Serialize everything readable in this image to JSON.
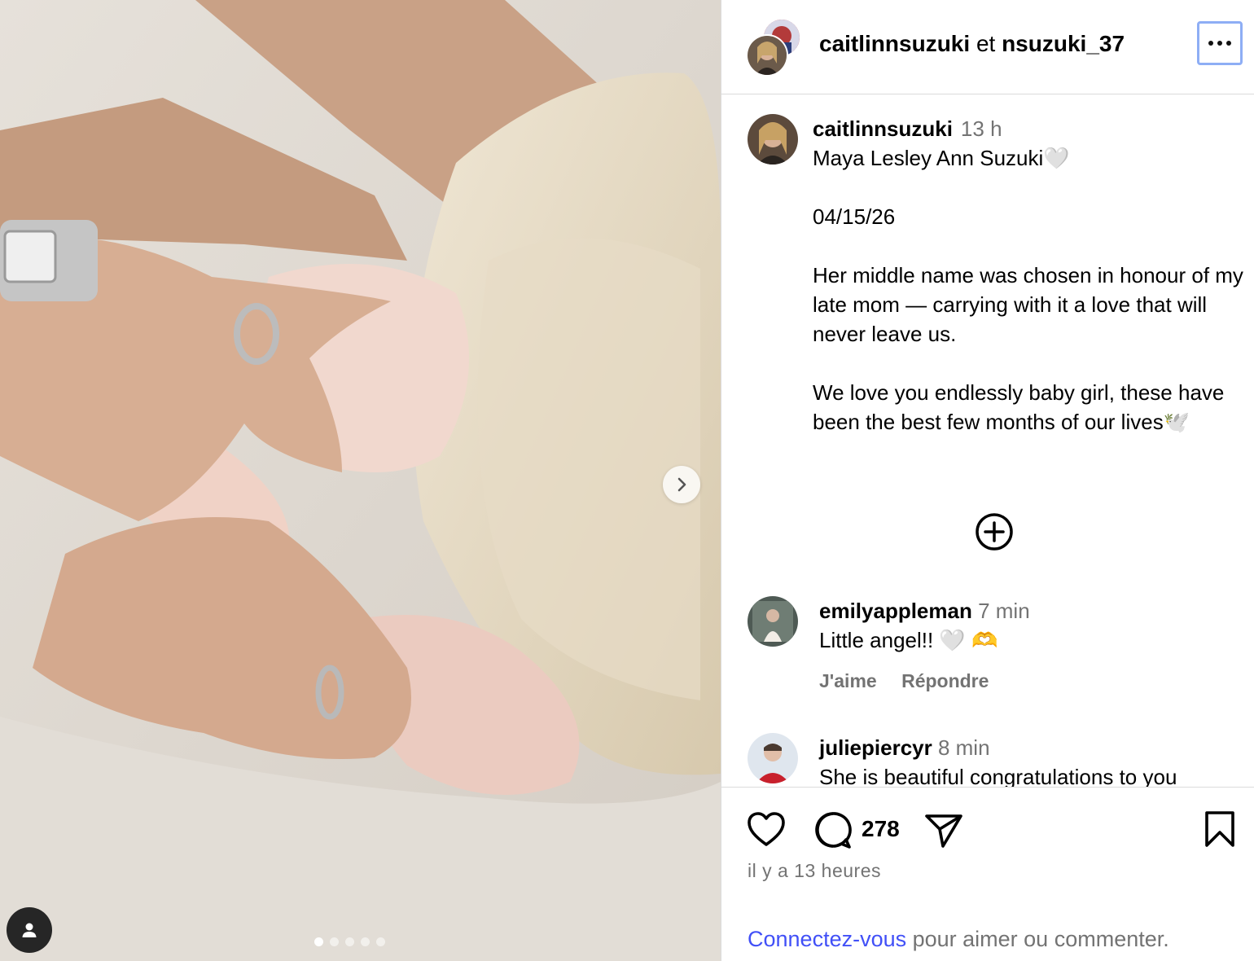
{
  "post": {
    "collaborators": {
      "user1": "caitlinnsuzuki",
      "joiner": "et",
      "user2": "nsuzuki_37"
    },
    "more_label": "More options",
    "media": {
      "slide_count": 5,
      "active_slide": 1
    }
  },
  "caption": {
    "username": "caitlinnsuzuki",
    "time": "13 h",
    "line1": "Maya Lesley Ann Suzuki🤍",
    "line2": "04/15/26",
    "line3": "Her middle name was chosen in honour of my late mom — carrying with it a love that will never leave us.",
    "line4": "We love you endlessly baby girl, these have been the best few months of our lives🕊️"
  },
  "comments": [
    {
      "username": "emilyappleman",
      "time": "7 min",
      "text": "Little angel!! 🤍 🫶",
      "like": "J'aime",
      "reply": "Répondre"
    },
    {
      "username": "juliepiercyr",
      "time": "8 min",
      "text": "She is beautiful congratulations to you"
    }
  ],
  "actions": {
    "comment_count": "278"
  },
  "timestamp": "il y a 13 heures",
  "login": {
    "link": "Connectez-vous",
    "rest": " pour aimer ou commenter."
  },
  "icons": [
    "chevron-right-icon",
    "user-tag-icon",
    "more-icon",
    "plus-circle-icon",
    "heart-icon",
    "comment-icon",
    "share-icon",
    "bookmark-icon"
  ],
  "colors": {
    "link": "#4150f7",
    "secondary_text": "#737373",
    "divider": "#dbdbdb",
    "focus_ring": "#8eaef5"
  }
}
